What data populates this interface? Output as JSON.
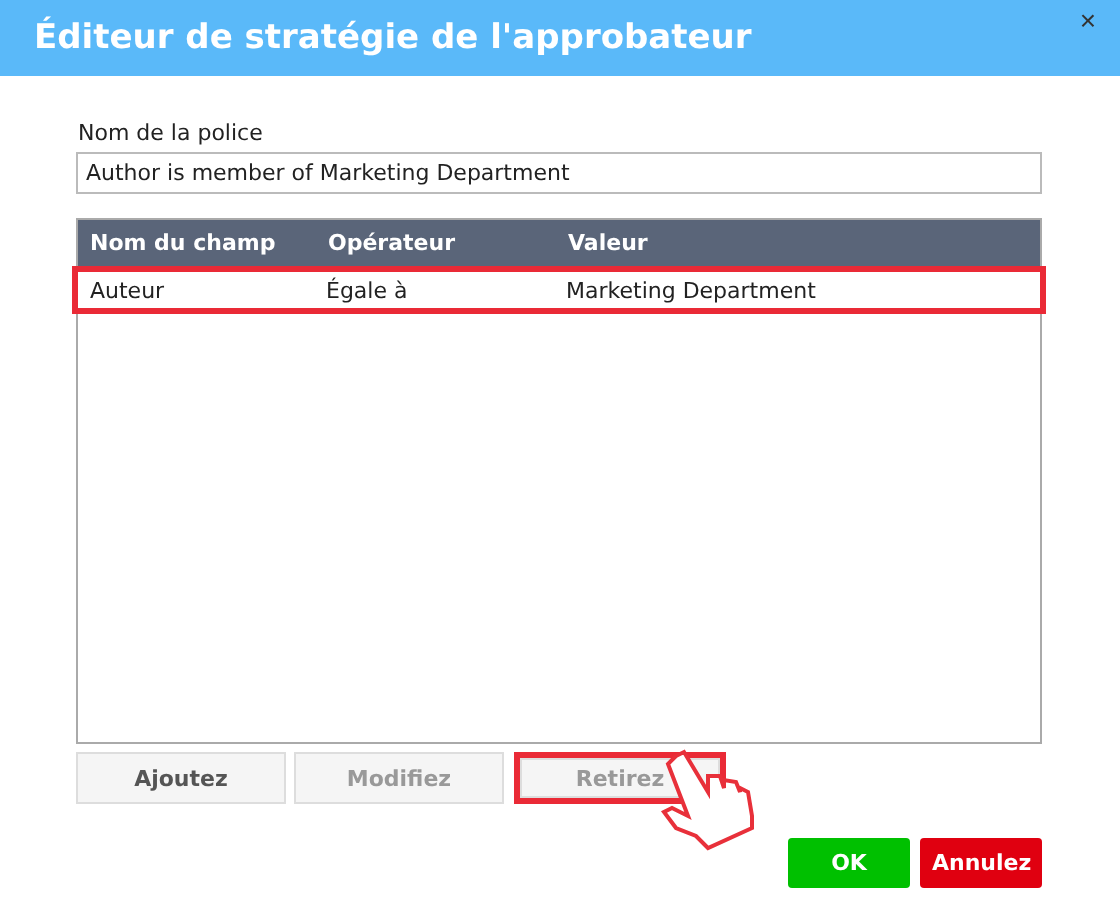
{
  "window": {
    "title": "Éditeur de stratégie de l'approbateur",
    "close": "×"
  },
  "policy_name": {
    "label": "Nom de la police",
    "value": "Author is member of Marketing Department"
  },
  "table": {
    "columns": [
      "Nom du champ",
      "Opérateur",
      "Valeur"
    ],
    "rows": [
      {
        "cells": [
          "Auteur",
          "Égale à",
          "Marketing Department"
        ],
        "selected": true
      }
    ]
  },
  "actions": [
    {
      "label": "Ajoutez",
      "disabled": false,
      "highlighted": false
    },
    {
      "label": "Modifiez",
      "disabled": true,
      "highlighted": false
    },
    {
      "label": "Retirez",
      "disabled": true,
      "highlighted": true
    }
  ],
  "buttons": [
    {
      "label": "OK",
      "kind": "confirm"
    },
    {
      "label": "Annulez",
      "kind": "cancel"
    }
  ]
}
